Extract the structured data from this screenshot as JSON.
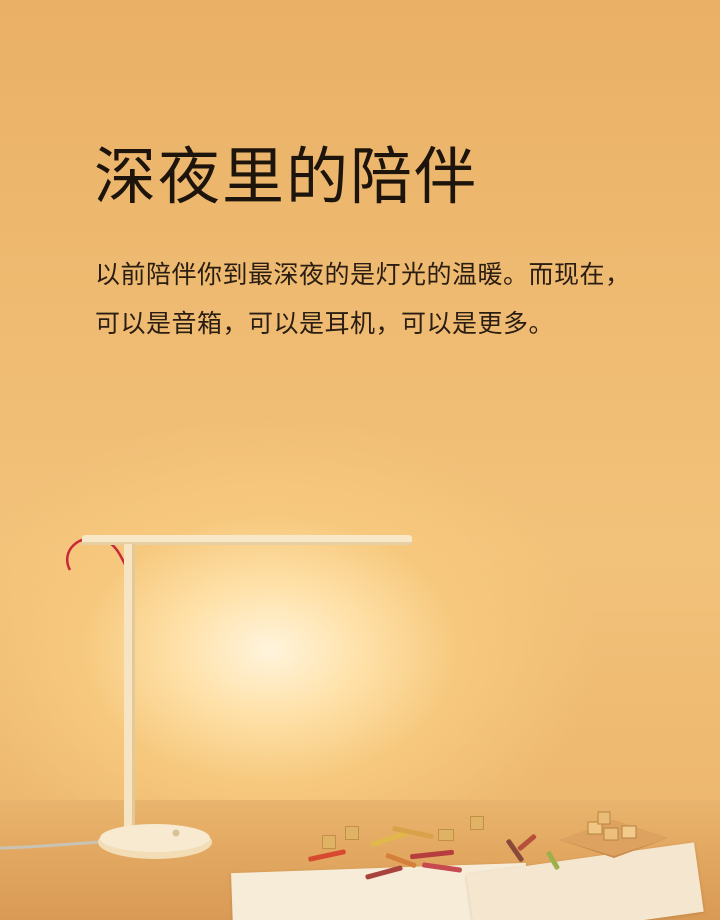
{
  "hero": {
    "headline": "深夜里的陪伴",
    "body": "以前陪伴你到最深夜的是灯光的温暖。而现在，可以是音箱，可以是耳机，可以是更多。"
  }
}
